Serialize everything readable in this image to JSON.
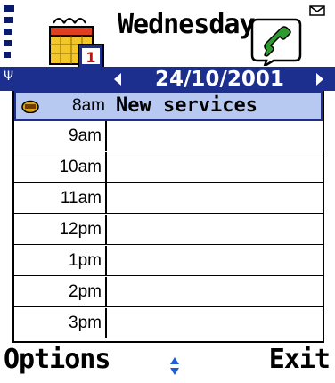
{
  "header": {
    "title": "Wednesday",
    "date": "24/10/2001"
  },
  "icons": {
    "signal": "signal-strength-icon",
    "app": "calendar-icon",
    "call": "call-active-icon",
    "message": "envelope-icon",
    "antenna": "antenna-icon",
    "alarm": "alarm-icon"
  },
  "colors": {
    "accent": "#1c2f8f",
    "selection": "#b7c9f0"
  },
  "day_view": {
    "rows": [
      {
        "time": "8am",
        "entry": "New services"
      },
      {
        "time": "9am",
        "entry": ""
      },
      {
        "time": "10am",
        "entry": ""
      },
      {
        "time": "11am",
        "entry": ""
      },
      {
        "time": "12pm",
        "entry": ""
      },
      {
        "time": "1pm",
        "entry": ""
      },
      {
        "time": "2pm",
        "entry": ""
      },
      {
        "time": "3pm",
        "entry": ""
      }
    ]
  },
  "softkeys": {
    "left": "Options",
    "right": "Exit"
  }
}
